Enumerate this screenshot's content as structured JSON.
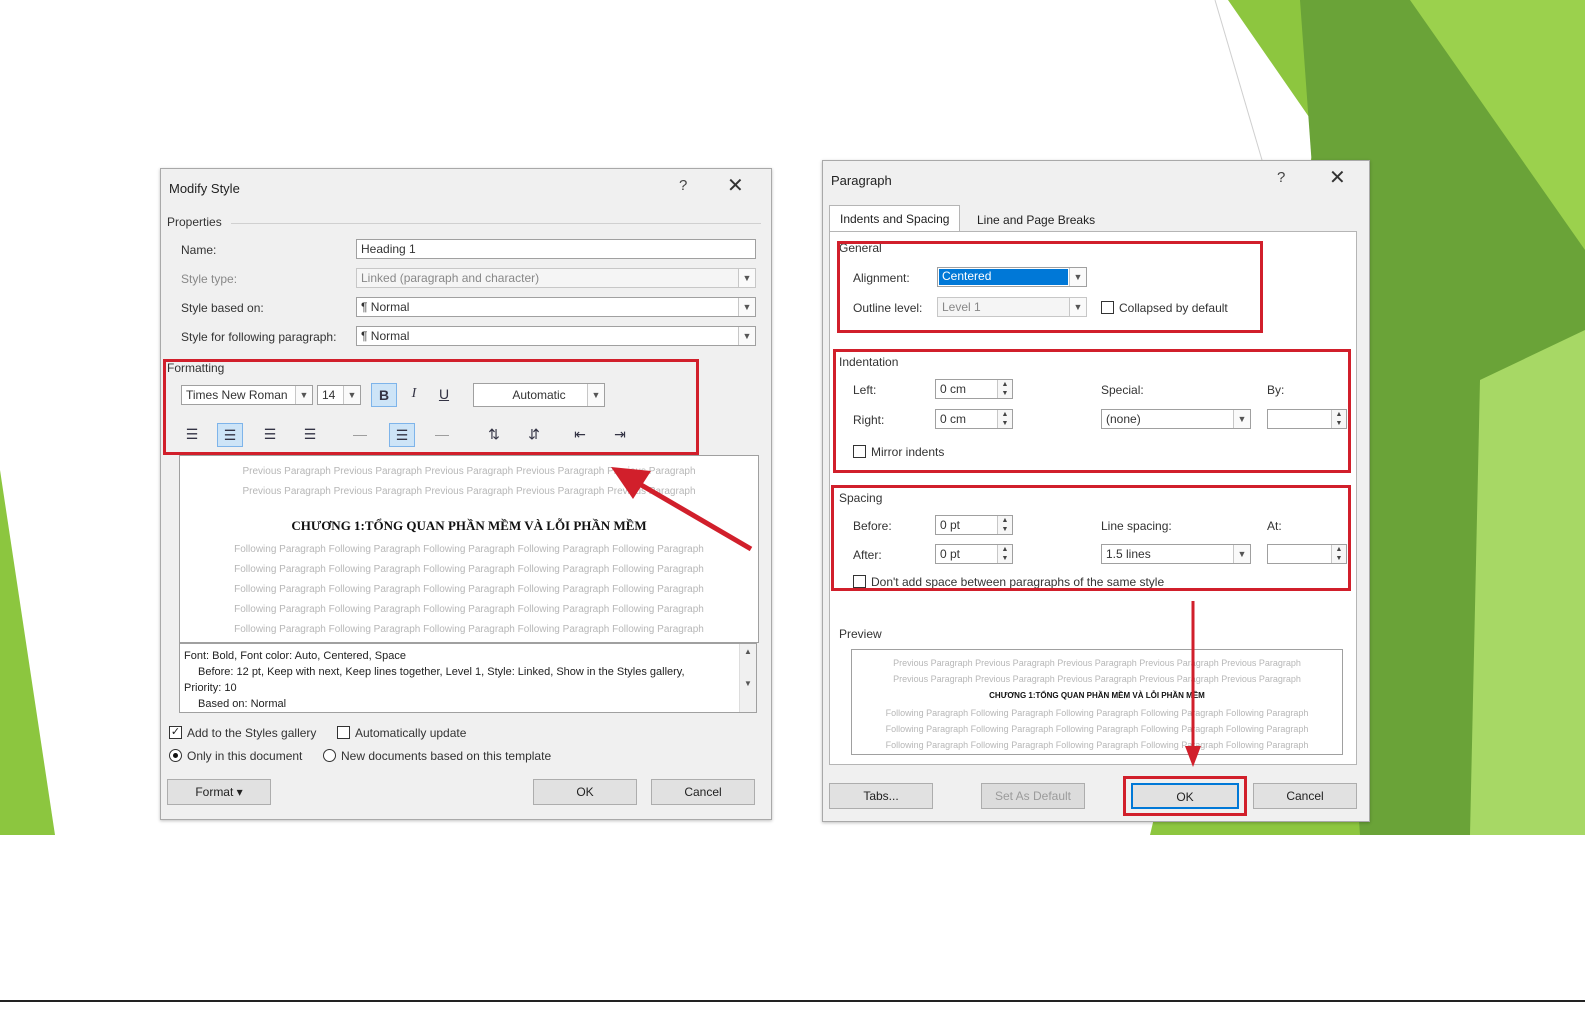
{
  "modify_style": {
    "title": "Modify Style",
    "help": "?",
    "close": "✕",
    "properties_label": "Properties",
    "name_label": "Name:",
    "name_value": "Heading 1",
    "style_type_label": "Style type:",
    "style_type_value": "Linked (paragraph and character)",
    "based_on_label": "Style based on:",
    "based_on_value": "¶ Normal",
    "following_label": "Style for following paragraph:",
    "following_value": "¶ Normal",
    "formatting_label": "Formatting",
    "font_value": "Times New Roman",
    "size_value": "14",
    "bold": "B",
    "italic": "I",
    "underline": "U",
    "color_value": "Automatic",
    "preview_prev_1": "Previous Paragraph Previous Paragraph Previous Paragraph Previous Paragraph Previous Paragraph",
    "preview_prev_2": "Previous Paragraph Previous Paragraph Previous Paragraph Previous Paragraph Previous Paragraph",
    "preview_heading": "CHƯƠNG 1:TỔNG QUAN PHẦN MỀM VÀ LỖI PHẦN MỀM",
    "preview_follow": "Following Paragraph Following Paragraph Following Paragraph Following Paragraph Following Paragraph",
    "desc_line1": "Font: Bold, Font color: Auto, Centered, Space",
    "desc_line2": "Before:  12 pt, Keep with next, Keep lines together, Level 1, Style: Linked, Show in the Styles gallery,",
    "desc_line3": "Priority: 10",
    "desc_line4": "Based on: Normal",
    "add_gallery_label": "Add to the Styles gallery",
    "auto_update_label": "Automatically update",
    "only_doc_label": "Only in this document",
    "new_docs_label": "New documents based on this template",
    "format_button": "Format ▾",
    "ok_button": "OK",
    "cancel_button": "Cancel"
  },
  "paragraph": {
    "title": "Paragraph",
    "help": "?",
    "close": "✕",
    "tab_indents": "Indents and Spacing",
    "tab_breaks": "Line and Page Breaks",
    "general_label": "General",
    "alignment_label": "Alignment:",
    "alignment_value": "Centered",
    "outline_label": "Outline level:",
    "outline_value": "Level 1",
    "collapsed_label": "Collapsed by default",
    "indentation_label": "Indentation",
    "left_label": "Left:",
    "left_value": "0 cm",
    "right_label": "Right:",
    "right_value": "0 cm",
    "special_label": "Special:",
    "special_value": "(none)",
    "by_label": "By:",
    "mirror_label": "Mirror indents",
    "spacing_label": "Spacing",
    "before_label": "Before:",
    "before_value": "0 pt",
    "after_label": "After:",
    "after_value": "0 pt",
    "line_spacing_label": "Line spacing:",
    "line_spacing_value": "1.5 lines",
    "at_label": "At:",
    "dont_add_label": "Don't add space between paragraphs of the same style",
    "preview_label": "Preview",
    "preview_prev": "Previous Paragraph Previous Paragraph Previous Paragraph Previous Paragraph Previous Paragraph",
    "preview_heading": "CHƯƠNG 1:TỔNG QUAN PHẦN MỀM VÀ LỖI PHẦN MỀM",
    "preview_follow": "Following Paragraph Following Paragraph Following Paragraph Following Paragraph Following Paragraph",
    "tabs_button": "Tabs...",
    "default_button": "Set As Default",
    "ok_button": "OK",
    "cancel_button": "Cancel"
  },
  "colors": {
    "highlight": "#d11f2b",
    "accent_green": "#8dc63f",
    "selection_blue": "#0078d7"
  }
}
